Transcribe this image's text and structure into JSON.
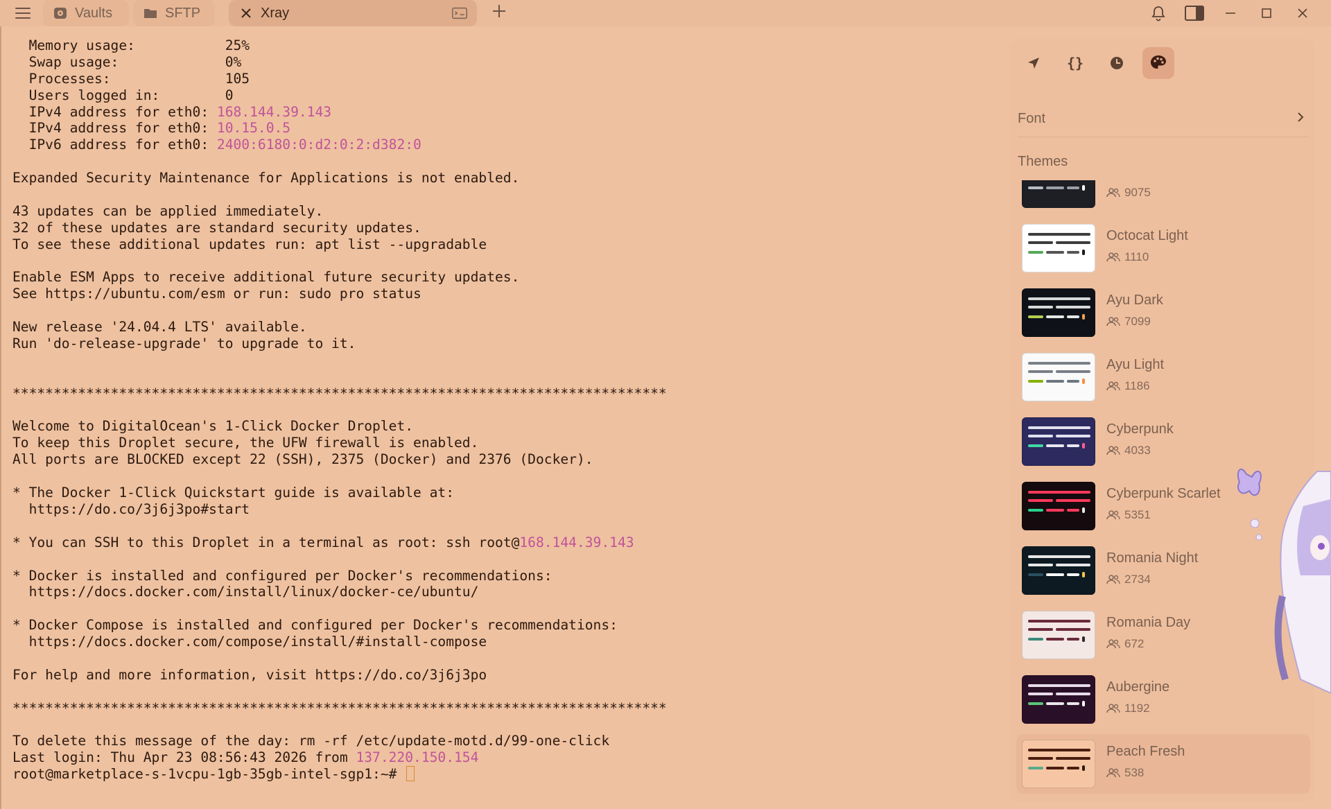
{
  "tabs": [
    {
      "label": "Vaults",
      "icon": "vault-icon"
    },
    {
      "label": "SFTP",
      "icon": "folder-icon"
    },
    {
      "label": "Xray",
      "icon": "close-icon"
    }
  ],
  "terminal": {
    "lines": [
      [
        {
          "t": "  Memory usage:           25%"
        }
      ],
      [
        {
          "t": "  Swap usage:             0%"
        }
      ],
      [
        {
          "t": "  Processes:              105"
        }
      ],
      [
        {
          "t": "  Users logged in:        0"
        }
      ],
      [
        {
          "t": "  IPv4 address for eth0: "
        },
        {
          "t": "168.144.39.143",
          "ip": true
        }
      ],
      [
        {
          "t": "  IPv4 address for eth0: "
        },
        {
          "t": "10.15.0.5",
          "ip": true
        }
      ],
      [
        {
          "t": "  IPv6 address for eth0: "
        },
        {
          "t": "2400:6180:0:d2:0:2:d382:0",
          "ip": true
        }
      ],
      [
        {
          "t": ""
        }
      ],
      [
        {
          "t": "Expanded Security Maintenance for Applications is not enabled."
        }
      ],
      [
        {
          "t": ""
        }
      ],
      [
        {
          "t": "43 updates can be applied immediately."
        }
      ],
      [
        {
          "t": "32 of these updates are standard security updates."
        }
      ],
      [
        {
          "t": "To see these additional updates run: apt list --upgradable"
        }
      ],
      [
        {
          "t": ""
        }
      ],
      [
        {
          "t": "Enable ESM Apps to receive additional future security updates."
        }
      ],
      [
        {
          "t": "See https://ubuntu.com/esm or run: sudo pro status"
        }
      ],
      [
        {
          "t": ""
        }
      ],
      [
        {
          "t": "New release '24.04.4 LTS' available."
        }
      ],
      [
        {
          "t": "Run 'do-release-upgrade' to upgrade to it."
        }
      ],
      [
        {
          "t": ""
        }
      ],
      [
        {
          "t": ""
        }
      ],
      [
        {
          "t": "********************************************************************************"
        }
      ],
      [
        {
          "t": ""
        }
      ],
      [
        {
          "t": "Welcome to DigitalOcean's 1-Click Docker Droplet."
        }
      ],
      [
        {
          "t": "To keep this Droplet secure, the UFW firewall is enabled."
        }
      ],
      [
        {
          "t": "All ports are BLOCKED except 22 (SSH), 2375 (Docker) and 2376 (Docker)."
        }
      ],
      [
        {
          "t": ""
        }
      ],
      [
        {
          "t": "* The Docker 1-Click Quickstart guide is available at:"
        }
      ],
      [
        {
          "t": "  https://do.co/3j6j3po#start"
        }
      ],
      [
        {
          "t": ""
        }
      ],
      [
        {
          "t": "* You can SSH to this Droplet in a terminal as root: ssh root@"
        },
        {
          "t": "168.144.39.143",
          "ip": true
        }
      ],
      [
        {
          "t": ""
        }
      ],
      [
        {
          "t": "* Docker is installed and configured per Docker's recommendations:"
        }
      ],
      [
        {
          "t": "  https://docs.docker.com/install/linux/docker-ce/ubuntu/"
        }
      ],
      [
        {
          "t": ""
        }
      ],
      [
        {
          "t": "* Docker Compose is installed and configured per Docker's recommendations:"
        }
      ],
      [
        {
          "t": "  https://docs.docker.com/compose/install/#install-compose"
        }
      ],
      [
        {
          "t": ""
        }
      ],
      [
        {
          "t": "For help and more information, visit https://do.co/3j6j3po"
        }
      ],
      [
        {
          "t": ""
        }
      ],
      [
        {
          "t": "********************************************************************************"
        }
      ],
      [
        {
          "t": ""
        }
      ],
      [
        {
          "t": "To delete this message of the day: rm -rf /etc/update-motd.d/99-one-click"
        }
      ],
      [
        {
          "t": "Last login: Thu Apr 23 08:56:43 2026 from "
        },
        {
          "t": "137.220.150.154",
          "ip": true
        }
      ],
      [
        {
          "t": "root@marketplace-s-1vcpu-1gb-35gb-intel-sgp1:~# "
        },
        {
          "cursor": true
        }
      ]
    ]
  },
  "panel": {
    "tabs": [
      {
        "icon": "rocket-icon"
      },
      {
        "icon": "braces-icon"
      },
      {
        "icon": "clock-icon"
      },
      {
        "icon": "palette-icon",
        "active": true
      }
    ],
    "font_label": "Font",
    "themes_title": "Themes",
    "themes": [
      {
        "name": "",
        "count": "9075",
        "bg": "#1e1f24",
        "colors": [
          "#7ec67a",
          "#b8bcc4",
          "#9aa0a8",
          "#ffffff"
        ]
      },
      {
        "name": "Octocat Light",
        "count": "1110",
        "bg": "#ffffff",
        "colors": [
          "#3d3d3d",
          "#56a85a",
          "#555555",
          "#1a1a1a"
        ]
      },
      {
        "name": "Ayu Dark",
        "count": "7099",
        "bg": "#0e1218",
        "colors": [
          "#d8d8d8",
          "#b8cc52",
          "#e6e6e6",
          "#f29e50"
        ]
      },
      {
        "name": "Ayu Light",
        "count": "1186",
        "bg": "#fafafa",
        "colors": [
          "#7a8088",
          "#86b300",
          "#6c7680",
          "#fa8d3e"
        ]
      },
      {
        "name": "Cyberpunk",
        "count": "4033",
        "bg": "#2c2a5e",
        "colors": [
          "#e0e0f0",
          "#42d7a5",
          "#e8e8f0",
          "#ff5d8f"
        ]
      },
      {
        "name": "Cyberpunk Scarlet",
        "count": "5351",
        "bg": "#150a0e",
        "colors": [
          "#ff3a5c",
          "#2ad18a",
          "#ff3a5c",
          "#e8e8e8"
        ]
      },
      {
        "name": "Romania Night",
        "count": "2734",
        "bg": "#0d1a22",
        "colors": [
          "#e8e8e8",
          "#2a5060",
          "#ffffff",
          "#f4c64a"
        ]
      },
      {
        "name": "Romania Day",
        "count": "672",
        "bg": "#f4e8e4",
        "colors": [
          "#6a2a3a",
          "#3a8a7a",
          "#6a2a3a",
          "#2a2a2a"
        ]
      },
      {
        "name": "Aubergine",
        "count": "1192",
        "bg": "#2a0f28",
        "colors": [
          "#e8dce8",
          "#5cc57a",
          "#e8e8e8",
          "#ffffff"
        ]
      },
      {
        "name": "Peach Fresh",
        "count": "538",
        "bg": "#f6c6a4",
        "colors": [
          "#4a1e10",
          "#5aaa8a",
          "#4a1e10",
          "#2a1a10"
        ],
        "selected": true
      }
    ]
  }
}
